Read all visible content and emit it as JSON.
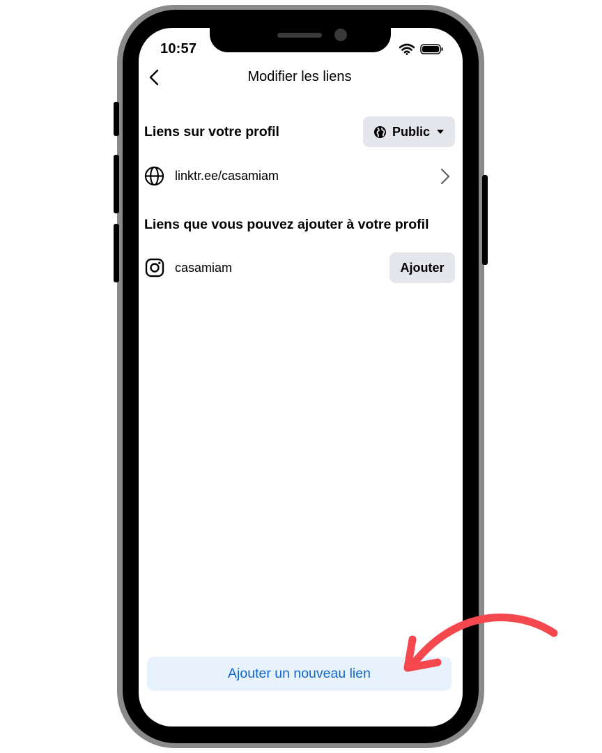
{
  "status_bar": {
    "time": "10:57",
    "icons": [
      "wifi-icon",
      "battery-icon"
    ]
  },
  "header": {
    "title": "Modifier les liens",
    "back_icon": "chevron-left-icon"
  },
  "profile_links": {
    "heading": "Liens sur votre profil",
    "visibility": {
      "label": "Public",
      "icon": "globe-icon",
      "caret": "caret-down-icon"
    },
    "items": [
      {
        "icon": "globe-icon",
        "label": "linktr.ee/casamiam",
        "trailing": "chevron-right-icon"
      }
    ]
  },
  "suggested_links": {
    "heading": "Liens que vous pouvez ajouter à votre profil",
    "items": [
      {
        "icon": "instagram-icon",
        "label": "casamiam",
        "action": "Ajouter"
      }
    ]
  },
  "footer": {
    "add_link_label": "Ajouter un nouveau lien"
  },
  "annotation": {
    "icon": "red-arrow-icon",
    "color": "#f4474e"
  },
  "colors": {
    "accent": "#1066c8",
    "chip_bg": "#e4e6eb",
    "cta_bg": "#e7f2fd"
  }
}
